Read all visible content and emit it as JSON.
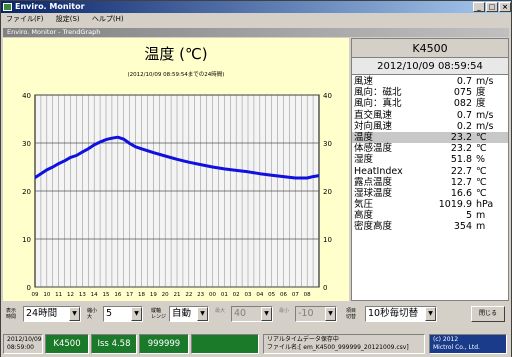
{
  "window": {
    "title": "Enviro. Monitor"
  },
  "menu": [
    "ファイル(F)",
    "設定(S)",
    "ヘルプ(H)"
  ],
  "subtitle": "Enviro. Monitor - TrendGraph",
  "chart": {
    "title": "温度 (℃)",
    "subtitle": "(2012/10/09 08:59:54までの24時間)"
  },
  "chart_data": {
    "type": "line",
    "title": "温度 (℃)",
    "ylim": [
      0,
      40
    ],
    "yticks": [
      "0",
      "10",
      "20",
      "30",
      "40"
    ],
    "x_ticks": [
      "09",
      "10",
      "11",
      "12",
      "13",
      "14",
      "15",
      "16",
      "17",
      "18",
      "19",
      "20",
      "21",
      "22",
      "23",
      "00",
      "01",
      "02",
      "03",
      "04",
      "05",
      "06",
      "07",
      "08"
    ],
    "series": [
      {
        "color": "#1010e0",
        "x": [
          0,
          0.5,
          1,
          1.5,
          2,
          2.5,
          3,
          3.5,
          4,
          4.5,
          5,
          5.5,
          6,
          6.5,
          7,
          7.5,
          8,
          8.5,
          9,
          10,
          11,
          12,
          13,
          14,
          15,
          16,
          17,
          18,
          19,
          20,
          21,
          22,
          23,
          23.5,
          24
        ],
        "values": [
          22.8,
          23.6,
          24.4,
          25.0,
          25.7,
          26.3,
          27.0,
          27.4,
          28.1,
          28.8,
          29.6,
          30.2,
          30.7,
          31.0,
          31.2,
          30.8,
          29.9,
          29.2,
          28.8,
          28.0,
          27.3,
          26.6,
          26.0,
          25.5,
          25.0,
          24.6,
          24.3,
          24.0,
          23.6,
          23.3,
          23.0,
          22.7,
          22.7,
          23.0,
          23.2
        ]
      }
    ]
  },
  "station": "K4500",
  "datetime": "2012/10/09 08:59:54",
  "readings": [
    {
      "label": "風速",
      "value": "0.7",
      "unit": "m/s"
    },
    {
      "label": "風向：磁北",
      "value": "075",
      "unit": "度"
    },
    {
      "label": "風向：真北",
      "value": "082",
      "unit": "度"
    },
    {
      "label": "直交風速",
      "value": "0.7",
      "unit": "m/s"
    },
    {
      "label": "対向風速",
      "value": "0.2",
      "unit": "m/s"
    },
    {
      "label": "温度",
      "value": "23.2",
      "unit": "℃"
    },
    {
      "label": "体感温度",
      "value": "23.2",
      "unit": "℃"
    },
    {
      "label": "湿度",
      "value": "51.8",
      "unit": "%"
    },
    {
      "label": "HeatIndex",
      "value": "22.7",
      "unit": "℃"
    },
    {
      "label": "露点温度",
      "value": "12.7",
      "unit": "℃"
    },
    {
      "label": "湿球温度",
      "value": "16.6",
      "unit": "℃"
    },
    {
      "label": "気圧",
      "value": "1019.9",
      "unit": "hPa"
    },
    {
      "label": "高度",
      "value": "5",
      "unit": "m"
    },
    {
      "label": "密度高度",
      "value": "354",
      "unit": "m"
    }
  ],
  "controls": {
    "period_label1": "表示",
    "period_label2": "時間",
    "period_value": "24時間",
    "scale_label1": "縮小",
    "scale_label2": "大",
    "scale_value": "5",
    "range_label1": "縦軸",
    "range_label2": "レンジ",
    "range_value": "自動",
    "max_label": "最大",
    "max_value": "40",
    "min_label": "最小",
    "min_value": "-10",
    "switch_label1": "項目",
    "switch_label2": "切替",
    "switch_value": "10秒毎切替",
    "close_label": "閉じる"
  },
  "statusbar": {
    "date": "2012/10/09",
    "time": "08:59:00",
    "station": "K4500",
    "iss": "Iss 4.58",
    "code": "999999",
    "realtime1": "リアルタイムデータ保存中",
    "realtime2": "ファイル名:[ em_K4500_999999_20121009.csv]",
    "copyright1": "(c) 2012",
    "copyright2": "Mictrol Co., Ltd."
  }
}
